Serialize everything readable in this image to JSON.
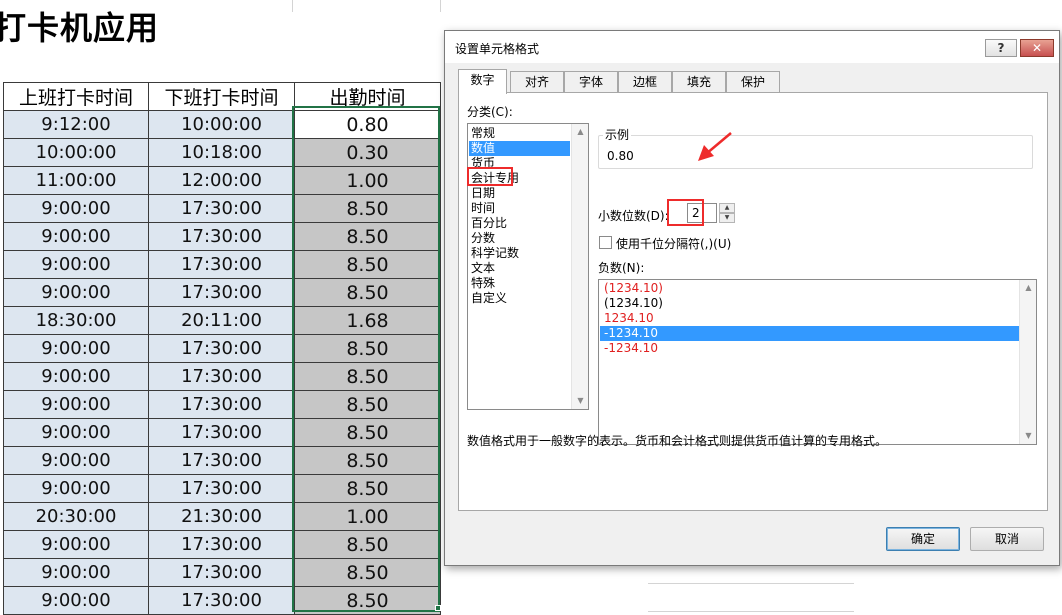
{
  "sheet": {
    "title": "打卡机应用",
    "headers": [
      "上班打卡时间",
      "下班打卡时间",
      "出勤时间"
    ],
    "rows": [
      [
        "9:12:00",
        "10:00:00",
        "0.80"
      ],
      [
        "10:00:00",
        "10:18:00",
        "0.30"
      ],
      [
        "11:00:00",
        "12:00:00",
        "1.00"
      ],
      [
        "9:00:00",
        "17:30:00",
        "8.50"
      ],
      [
        "9:00:00",
        "17:30:00",
        "8.50"
      ],
      [
        "9:00:00",
        "17:30:00",
        "8.50"
      ],
      [
        "9:00:00",
        "17:30:00",
        "8.50"
      ],
      [
        "18:30:00",
        "20:11:00",
        "1.68"
      ],
      [
        "9:00:00",
        "17:30:00",
        "8.50"
      ],
      [
        "9:00:00",
        "17:30:00",
        "8.50"
      ],
      [
        "9:00:00",
        "17:30:00",
        "8.50"
      ],
      [
        "9:00:00",
        "17:30:00",
        "8.50"
      ],
      [
        "9:00:00",
        "17:30:00",
        "8.50"
      ],
      [
        "9:00:00",
        "17:30:00",
        "8.50"
      ],
      [
        "20:30:00",
        "21:30:00",
        "1.00"
      ],
      [
        "9:00:00",
        "17:30:00",
        "8.50"
      ],
      [
        "9:00:00",
        "17:30:00",
        "8.50"
      ],
      [
        "9:00:00",
        "17:30:00",
        "8.50"
      ]
    ]
  },
  "dialog": {
    "title": "设置单元格格式",
    "help_label": "?",
    "close_label": "✕",
    "tabs": [
      "数字",
      "对齐",
      "字体",
      "边框",
      "填充",
      "保护"
    ],
    "active_tab": "数字",
    "category_label": "分类(C):",
    "categories": [
      "常规",
      "数值",
      "货币",
      "会计专用",
      "日期",
      "时间",
      "百分比",
      "分数",
      "科学记数",
      "文本",
      "特殊",
      "自定义"
    ],
    "selected_category": "数值",
    "sample_label": "示例",
    "sample_value": "0.80",
    "decimal_label": "小数位数(D):",
    "decimal_value": "2",
    "thousands_label": "使用千位分隔符(,)(U)",
    "thousands_checked": false,
    "negative_label": "负数(N):",
    "negative_options": [
      {
        "text": "(1234.10)",
        "color": "#e02020"
      },
      {
        "text": "(1234.10)",
        "color": "#000000"
      },
      {
        "text": "1234.10",
        "color": "#e02020"
      },
      {
        "text": "-1234.10",
        "color": "#000000"
      },
      {
        "text": "-1234.10",
        "color": "#e02020"
      }
    ],
    "selected_negative": 3,
    "description": "数值格式用于一般数字的表示。货币和会计格式则提供货币值计算的专用格式。",
    "ok_label": "确定",
    "cancel_label": "取消"
  },
  "colors": {
    "selection_blue": "#3399ff",
    "annotation_red": "#ee2b2b",
    "excel_green": "#217346",
    "time_cell_bg": "#dde6f0",
    "duration_cell_bg": "#c6c6c6"
  }
}
